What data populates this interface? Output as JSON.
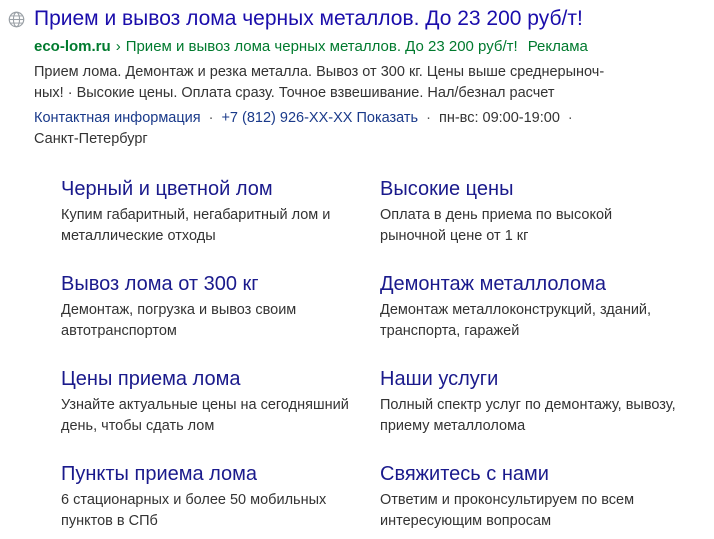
{
  "ad": {
    "title": "Прием и вывоз лома черных металлов. До 23 200 руб/т!",
    "domain": "eco-lom.ru",
    "breadcrumb_sep": "›",
    "path": "Прием и вывоз лома черных металлов. До 23 200 руб/т!",
    "ad_label": "Реклама",
    "description_line1": "Прием лома. Демонтаж и резка металла. Вывоз от 300 кг. Цены выше среднерыноч-",
    "description_line2": "ных! · Высокие цены. Оплата сразу. Точное взвешивание. Нал/безнал расчет",
    "contacts": {
      "contact_info_label": "Контактная информация",
      "separator": "·",
      "phone": "+7 (812) 926-XX-XX Показать",
      "hours": "пн-вс: 09:00-19:00",
      "city": "Санкт-Петербург"
    },
    "sitelinks": [
      {
        "title": "Черный и цветной лом",
        "description": "Купим габаритный, негабаритный лом и металлические отходы"
      },
      {
        "title": "Высокие цены",
        "description": "Оплата в день приема по высокой рыночной цене от 1 кг"
      },
      {
        "title": "Вывоз лома от 300 кг",
        "description": "Демонтаж, погрузка и вывоз своим автотранспортом"
      },
      {
        "title": "Демонтаж металлолома",
        "description": "Демонтаж металлоконструкций, зданий, транспорта, гаражей"
      },
      {
        "title": "Цены приема лома",
        "description": "Узнайте актуальные цены на сегодняшний день, чтобы сдать лом"
      },
      {
        "title": "Наши услуги",
        "description": "Полный спектр услуг по демонтажу, вывозу, приему металлолома"
      },
      {
        "title": "Пункты приема лома",
        "description": "6 стационарных и более 50 мобильных пунктов в СПб"
      },
      {
        "title": "Свяжитесь с нами",
        "description": "Ответим и проконсультируем по всем интересующим вопросам"
      }
    ],
    "icon": "globe-icon",
    "colors": {
      "title": "#1a0dab",
      "url": "#007a2e",
      "sitelink_title": "#1a1a8c",
      "contact_link": "#1a3a8a",
      "text": "#333333",
      "icon": "#9aa0a6"
    }
  }
}
